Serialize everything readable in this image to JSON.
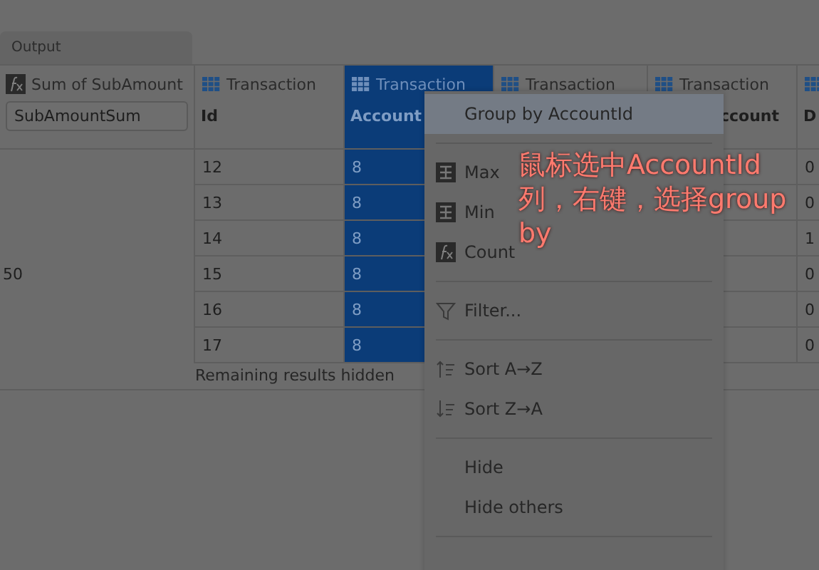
{
  "tab": {
    "label": "Output"
  },
  "table": {
    "columns": [
      {
        "kind": "formula",
        "title": "Sum of SubAmount",
        "value": "SubAmountSum",
        "selected": false
      },
      {
        "kind": "table",
        "title": "Transaction",
        "subtitle": "Id",
        "selected": false
      },
      {
        "kind": "table",
        "title": "Transaction",
        "subtitle": "Account",
        "selected": true
      },
      {
        "kind": "table",
        "title": "Transaction",
        "selected": false
      },
      {
        "kind": "table",
        "title": "Transaction",
        "subtitle": "ccount",
        "selected": false
      },
      {
        "kind": "table",
        "subtitle": "D",
        "selected": false
      }
    ],
    "rows": [
      [
        null,
        "12",
        "8",
        null,
        null,
        "0"
      ],
      [
        null,
        "13",
        "8",
        null,
        null,
        "0"
      ],
      [
        null,
        "14",
        "8",
        null,
        null,
        "1"
      ],
      [
        "50",
        "15",
        "8",
        null,
        null,
        "0"
      ],
      [
        null,
        "16",
        "8",
        null,
        null,
        "0"
      ],
      [
        null,
        "17",
        "8",
        null,
        null,
        "0"
      ]
    ],
    "footer": "Remaining results hidden"
  },
  "context_menu": {
    "items": [
      {
        "kind": "plain",
        "label": "Group by AccountId",
        "selected": true
      },
      {
        "kind": "separator"
      },
      {
        "kind": "aggregate",
        "label": "Max",
        "selected": false
      },
      {
        "kind": "aggregate",
        "label": "Min",
        "selected": false
      },
      {
        "kind": "formula",
        "label": "Count",
        "selected": false
      },
      {
        "kind": "separator"
      },
      {
        "kind": "filter",
        "label": "Filter...",
        "selected": false
      },
      {
        "kind": "separator"
      },
      {
        "kind": "sort-asc",
        "label": "Sort A→Z",
        "selected": false
      },
      {
        "kind": "sort-desc",
        "label": "Sort Z→A",
        "selected": false
      },
      {
        "kind": "separator"
      },
      {
        "kind": "plain",
        "label": "Hide",
        "selected": false
      },
      {
        "kind": "plain",
        "label": "Hide others",
        "selected": false
      },
      {
        "kind": "separator"
      }
    ]
  },
  "annotation": "鼠标选中AccountId列，右键，选择group by"
}
